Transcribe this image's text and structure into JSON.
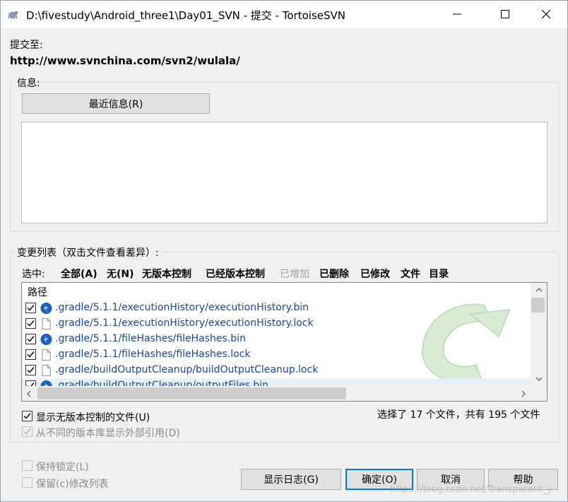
{
  "window": {
    "title": "D:\\fivestudy\\Android_three1\\Day01_SVN - 提交 - TortoiseSVN",
    "minimize_glyph": "—",
    "maximize_glyph": "☐",
    "close_glyph": "✕"
  },
  "commit_to": {
    "label": "提交至:",
    "url": "http://www.svnchina.com/svn2/wulala/"
  },
  "message": {
    "group_label": "信息:",
    "recent_button": "最近信息(R)",
    "text": ""
  },
  "changes": {
    "group_label": "变更列表（双击文件查看差异）:",
    "select_label": "选中:",
    "filters": [
      "全部(A)",
      "无(N)",
      "无版本控制",
      "已经版本控制",
      "已增加",
      "已删除",
      "已修改",
      "文件",
      "目录"
    ],
    "column_header": "路径",
    "files": [
      {
        "path": ".gradle/5.1.1/executionHistory/executionHistory.bin",
        "icon": "svn-add-icon"
      },
      {
        "path": ".gradle/5.1.1/executionHistory/executionHistory.lock",
        "icon": "file-icon"
      },
      {
        "path": ".gradle/5.1.1/fileHashes/fileHashes.bin",
        "icon": "svn-add-icon"
      },
      {
        "path": ".gradle/5.1.1/fileHashes/fileHashes.lock",
        "icon": "file-icon"
      },
      {
        "path": ".gradle/buildOutputCleanup/buildOutputCleanup.lock",
        "icon": "file-icon"
      },
      {
        "path": ".gradle/buildOutputCleanup/outputFiles.bin",
        "icon": "svn-add-icon"
      }
    ],
    "show_unversioned": "显示无版本控制的文件(U)",
    "show_externals": "从不同的版本库显示外部引用(D)",
    "summary": "选择了 17 个文件，共有 195 个文件"
  },
  "footer": {
    "keep_locks": "保持锁定(L)",
    "keep_changelists": "保留(c)修改列表",
    "show_log": "显示日志(G)",
    "ok": "确定(O)",
    "cancel": "取消",
    "help": "帮助",
    "watermark": "https://blog.csdn.net/Transparent_y"
  },
  "colors": {
    "accent": "#0078d7",
    "file_link": "#1a44a8",
    "disabled": "#a0a0a0"
  }
}
